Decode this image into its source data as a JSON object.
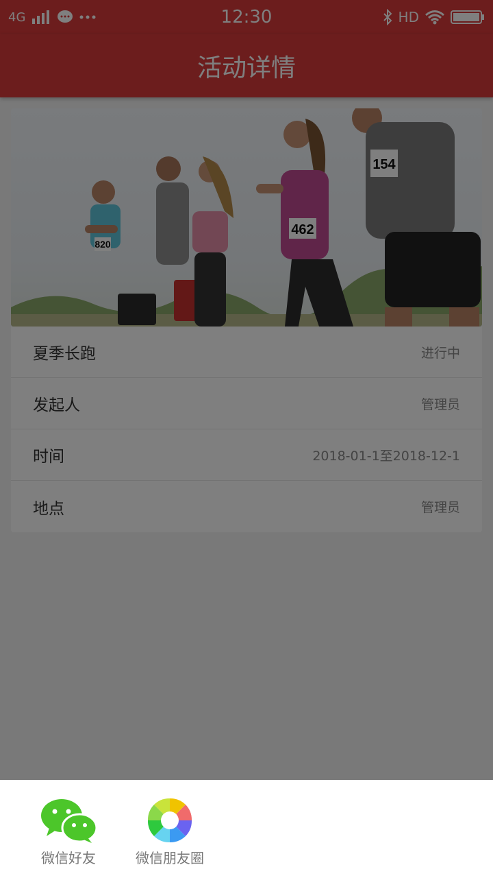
{
  "status_bar": {
    "network": "4G",
    "time": "12:30",
    "hd": "HD"
  },
  "header": {
    "title": "活动详情"
  },
  "activity": {
    "rows": [
      {
        "label": "夏季长跑",
        "value": "进行中"
      },
      {
        "label": "发起人",
        "value": "管理员"
      },
      {
        "label": "时间",
        "value": "2018-01-1至2018-12-1"
      },
      {
        "label": "地点",
        "value": "管理员"
      }
    ],
    "bib_numbers": [
      "820",
      "462",
      "154"
    ]
  },
  "share_sheet": {
    "items": [
      {
        "label": "微信好友",
        "icon": "wechat-icon"
      },
      {
        "label": "微信朋友圈",
        "icon": "moments-icon"
      }
    ]
  },
  "colors": {
    "brand": "#d93a3a",
    "wechat_green": "#4cc62a"
  }
}
